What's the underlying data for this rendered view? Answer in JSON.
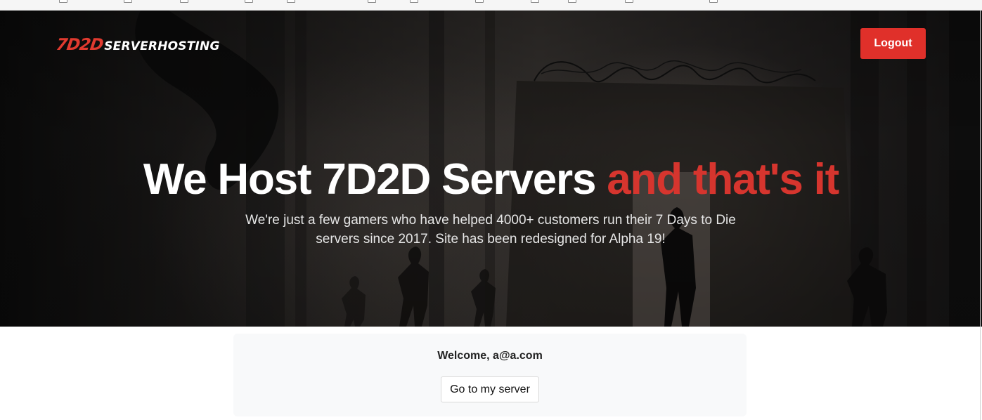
{
  "header": {
    "logo_mark": "7D2D",
    "logo_text": "SERVERHOSTING",
    "logout_label": "Logout"
  },
  "hero": {
    "title_main": "We Host 7D2D Servers ",
    "title_accent": "and that's it",
    "subtitle": "We're just a few gamers who have helped 4000+ customers run their 7 Days to Die servers since 2017. Site has been redesigned for Alpha 19!"
  },
  "welcome": {
    "greeting": "Welcome, a@a.com",
    "server_button_label": "Go to my server"
  },
  "colors": {
    "accent": "#e0302a",
    "hero_accent_text": "#d6352e",
    "card_background": "#f8f9fa"
  }
}
